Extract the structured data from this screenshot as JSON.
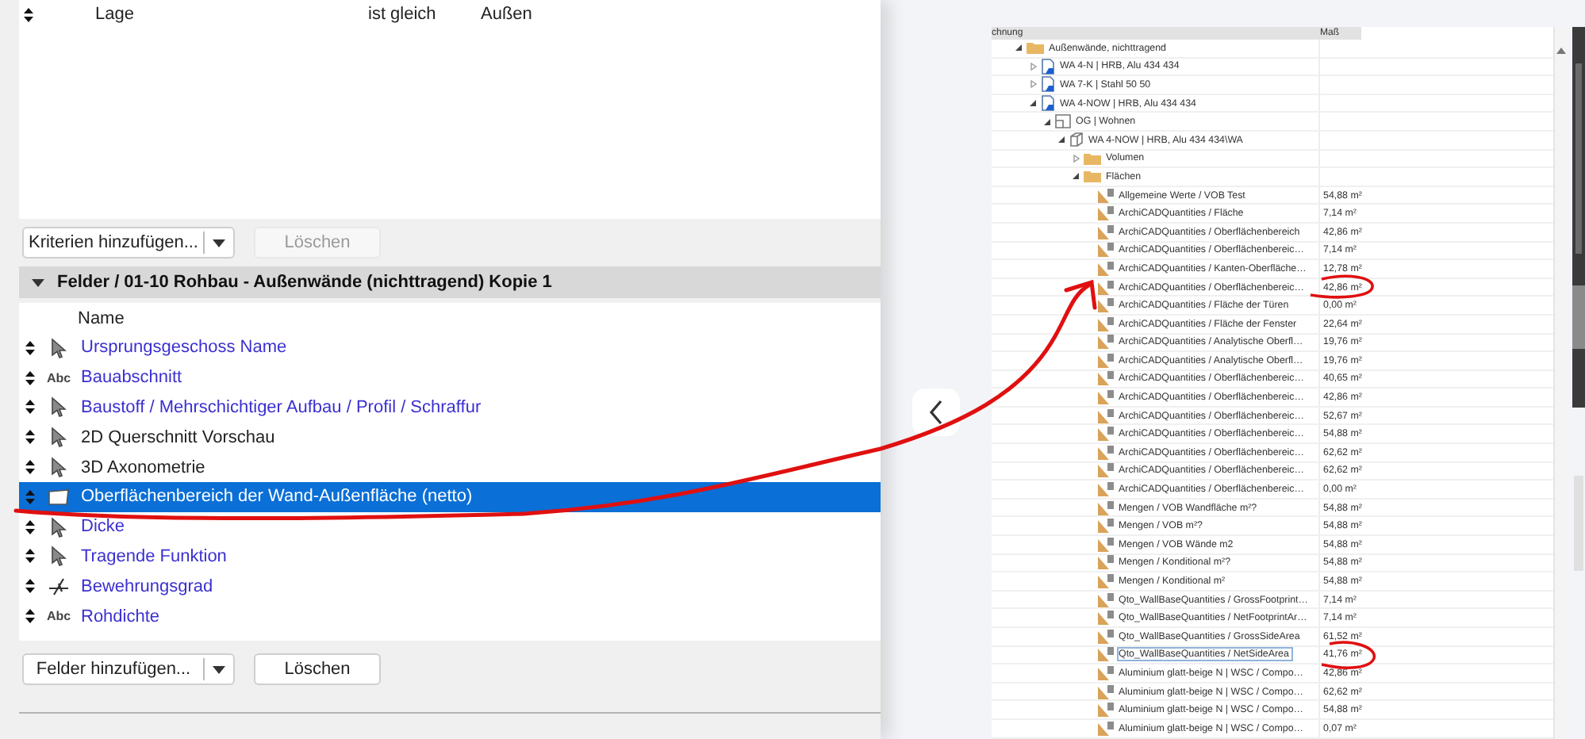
{
  "criteria": [
    {
      "field": "Lage",
      "operator": "ist gleich",
      "value": "Außen"
    }
  ],
  "criteria_buttons": {
    "add": {
      "label": "Kriterien hinzufügen..."
    },
    "delete": {
      "label": "Löschen",
      "disabled": true
    }
  },
  "fields_section": {
    "title": "Felder / 01-10 Rohbau - Außenwände (nichttragend) Kopie 1",
    "expanded": true,
    "column": "Name",
    "fields": [
      {
        "name": "Ursprungsgeschoss Name",
        "kind": "pointer",
        "linked": true,
        "selected": false
      },
      {
        "name": "Bauabschnitt",
        "kind": "text",
        "icon_text": "Abc",
        "linked": true,
        "selected": false
      },
      {
        "name": "Baustoff / Mehrschichtiger Aufbau / Profil / Schraffur",
        "kind": "pointer",
        "linked": true,
        "selected": false
      },
      {
        "name": "2D Querschnitt Vorschau",
        "kind": "pointer",
        "linked": false,
        "selected": false
      },
      {
        "name": "3D Axonometrie",
        "kind": "pointer",
        "linked": false,
        "selected": false
      },
      {
        "name": "Oberflächenbereich der Wand-Außenfläche (netto)",
        "kind": "surface",
        "linked": true,
        "selected": true
      },
      {
        "name": "Dicke",
        "kind": "pointer",
        "linked": true,
        "selected": false
      },
      {
        "name": "Tragende Funktion",
        "kind": "pointer",
        "linked": true,
        "selected": false
      },
      {
        "name": "Bewehrungsgrad",
        "kind": "rebar",
        "linked": true,
        "selected": false
      },
      {
        "name": "Rohdichte",
        "kind": "text",
        "icon_text": "Abc",
        "linked": true,
        "selected": false
      }
    ]
  },
  "fields_buttons": {
    "add": {
      "label": "Felder hinzufügen..."
    },
    "delete": {
      "label": "Löschen",
      "disabled": false
    }
  },
  "tree": {
    "columns": [
      "chnung",
      "Maß"
    ],
    "items": [
      {
        "label": "Außenwände, nichttragend",
        "kind": "folder",
        "expanded": true,
        "children": [
          {
            "label": "WA 4-N | HRB, Alu 434 434",
            "kind": "element",
            "expanded": false
          },
          {
            "label": "WA 7-K | Stahl 50 50",
            "kind": "element",
            "expanded": false
          },
          {
            "label": "WA 4-NOW | HRB, Alu 434 434",
            "kind": "element",
            "expanded": true,
            "children": [
              {
                "label": "OG | Wohnen",
                "kind": "story",
                "expanded": true,
                "children": [
                  {
                    "label": "WA 4-NOW | HRB, Alu 434 434\\WA",
                    "kind": "solid",
                    "expanded": true,
                    "children": [
                      {
                        "label": "Volumen",
                        "kind": "folder",
                        "expanded": false
                      },
                      {
                        "label": "Flächen",
                        "kind": "folder",
                        "expanded": true,
                        "children": [
                          {
                            "label": "Allgemeine Werte / VOB Test",
                            "kind": "quantity",
                            "value": "54,88 m²",
                            "selected": false
                          },
                          {
                            "label": "ArchiCADQuantities / Fläche",
                            "kind": "quantity",
                            "value": "7,14 m²",
                            "selected": false
                          },
                          {
                            "label": "ArchiCADQuantities / Oberflächenbereich",
                            "kind": "quantity",
                            "value": "42,86 m²",
                            "selected": false
                          },
                          {
                            "label": "ArchiCADQuantities / Oberflächenbereic…",
                            "kind": "quantity",
                            "value": "7,14 m²",
                            "selected": false
                          },
                          {
                            "label": "ArchiCADQuantities / Kanten-Oberfläche…",
                            "kind": "quantity",
                            "value": "12,78 m²",
                            "selected": false
                          },
                          {
                            "label": "ArchiCADQuantities / Oberflächenbereic…",
                            "kind": "quantity",
                            "value": "42,86 m²",
                            "selected": false
                          },
                          {
                            "label": "ArchiCADQuantities / Fläche der Türen",
                            "kind": "quantity",
                            "value": "0,00 m²",
                            "selected": false
                          },
                          {
                            "label": "ArchiCADQuantities / Fläche der Fenster",
                            "kind": "quantity",
                            "value": "22,64 m²",
                            "selected": false
                          },
                          {
                            "label": "ArchiCADQuantities / Analytische Oberfl…",
                            "kind": "quantity",
                            "value": "19,76 m²",
                            "selected": false
                          },
                          {
                            "label": "ArchiCADQuantities / Analytische Oberfl…",
                            "kind": "quantity",
                            "value": "19,76 m²",
                            "selected": false
                          },
                          {
                            "label": "ArchiCADQuantities / Oberflächenbereic…",
                            "kind": "quantity",
                            "value": "40,65 m²",
                            "selected": false
                          },
                          {
                            "label": "ArchiCADQuantities / Oberflächenbereic…",
                            "kind": "quantity",
                            "value": "42,86 m²",
                            "selected": false
                          },
                          {
                            "label": "ArchiCADQuantities / Oberflächenbereic…",
                            "kind": "quantity",
                            "value": "52,67 m²",
                            "selected": false
                          },
                          {
                            "label": "ArchiCADQuantities / Oberflächenbereic…",
                            "kind": "quantity",
                            "value": "54,88 m²",
                            "selected": false
                          },
                          {
                            "label": "ArchiCADQuantities / Oberflächenbereic…",
                            "kind": "quantity",
                            "value": "62,62 m²",
                            "selected": false
                          },
                          {
                            "label": "ArchiCADQuantities / Oberflächenbereic…",
                            "kind": "quantity",
                            "value": "62,62 m²",
                            "selected": false
                          },
                          {
                            "label": "ArchiCADQuantities / Oberflächenbereic…",
                            "kind": "quantity",
                            "value": "0,00 m²",
                            "selected": false
                          },
                          {
                            "label": "Mengen / VOB Wandfläche m²?",
                            "kind": "quantity",
                            "value": "54,88 m²",
                            "selected": false
                          },
                          {
                            "label": "Mengen / VOB m²?",
                            "kind": "quantity",
                            "value": "54,88 m²",
                            "selected": false
                          },
                          {
                            "label": "Mengen / VOB Wände m2",
                            "kind": "quantity",
                            "value": "54,88 m²",
                            "selected": false
                          },
                          {
                            "label": "Mengen / Konditional m²?",
                            "kind": "quantity",
                            "value": "54,88 m²",
                            "selected": false
                          },
                          {
                            "label": "Mengen / Konditional m²",
                            "kind": "quantity",
                            "value": "54,88 m²",
                            "selected": false
                          },
                          {
                            "label": "Qto_WallBaseQuantities / GrossFootprint…",
                            "kind": "quantity",
                            "value": "7,14 m²",
                            "selected": false
                          },
                          {
                            "label": "Qto_WallBaseQuantities / NetFootprintAr…",
                            "kind": "quantity",
                            "value": "7,14 m²",
                            "selected": false
                          },
                          {
                            "label": "Qto_WallBaseQuantities / GrossSideArea",
                            "kind": "quantity",
                            "value": "61,52 m²",
                            "selected": false
                          },
                          {
                            "label": "Qto_WallBaseQuantities / NetSideArea",
                            "kind": "quantity",
                            "value": "41,76 m²",
                            "selected": true
                          },
                          {
                            "label": "Aluminium glatt-beige N | WSC / Compo…",
                            "kind": "quantity",
                            "value": "42,86 m²",
                            "selected": false
                          },
                          {
                            "label": "Aluminium glatt-beige N | WSC / Compo…",
                            "kind": "quantity",
                            "value": "62,62 m²",
                            "selected": false
                          },
                          {
                            "label": "Aluminium glatt-beige N | WSC / Compo…",
                            "kind": "quantity",
                            "value": "54,88 m²",
                            "selected": false
                          },
                          {
                            "label": "Aluminium glatt-beige N | WSC / Compo…",
                            "kind": "quantity",
                            "value": "0,07 m²",
                            "selected": false
                          }
                        ]
                      }
                    ]
                  }
                ]
              }
            ]
          }
        ]
      }
    ]
  }
}
